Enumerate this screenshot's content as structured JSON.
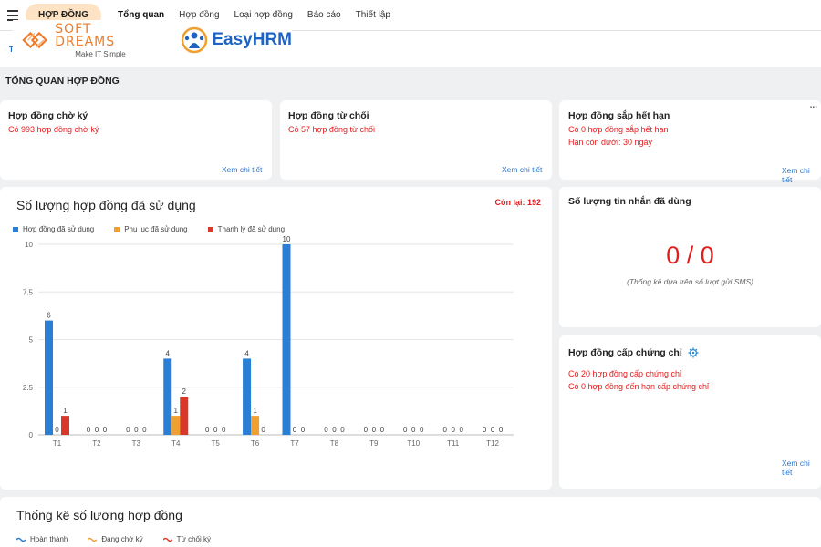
{
  "nav": {
    "module": "HỢP ĐỒNG",
    "items": [
      {
        "label": "Tổng quan",
        "active": true
      },
      {
        "label": "Hợp đồng",
        "active": false
      },
      {
        "label": "Loại hợp đồng",
        "active": false
      },
      {
        "label": "Báo cáo",
        "active": false
      },
      {
        "label": "Thiết lập",
        "active": false
      }
    ]
  },
  "tab_fragment": "Tổ",
  "logos": {
    "softdreams_name": "SOFT DREAMS",
    "softdreams_tagline": "Make IT Simple",
    "easyhrm": "EasyHRM"
  },
  "page": {
    "section_title": "TỔNG QUAN HỢP ĐỒNG"
  },
  "cards": {
    "pending": {
      "title": "Hợp đồng chờ ký",
      "line1": "Có 993 hợp đồng chờ ký",
      "link": "Xem chi tiết"
    },
    "rejected": {
      "title": "Hợp đồng từ chối",
      "line1": "Có 57 hợp đồng từ chối",
      "link": "Xem chi tiết"
    },
    "expiring": {
      "title": "Hợp đồng sắp hết hạn",
      "line1": "Có 0 hợp đồng sắp hết hạn",
      "line2": "Hạn còn dưới: 30 ngày",
      "link": "Xem chi tiết",
      "more": "..."
    },
    "sms": {
      "title": "Số lượng tin nhắn đã dùng",
      "value": "0 / 0",
      "note": "(Thống kê dựa trên số lượt gửi SMS)"
    },
    "certificate": {
      "title": "Hợp đồng cấp chứng chỉ",
      "line1": "Có 20 hợp đồng cấp chứng chỉ",
      "line2": "Có 0 hợp đồng đến hạn cấp chứng chỉ",
      "link": "Xem chi tiết"
    },
    "stats": {
      "title": "Thống kê số lượng hợp đồng",
      "legend": [
        {
          "label": "Hoàn thành",
          "color": "#2a7ed3"
        },
        {
          "label": "Đang chờ ký",
          "color": "#f0a030"
        },
        {
          "label": "Từ chối ký",
          "color": "#d8372a"
        }
      ]
    }
  },
  "usage": {
    "title": "Số lượng hợp đồng đã sử dụng",
    "remaining": "Còn lại: 192"
  },
  "chart_data": {
    "type": "bar",
    "categories": [
      "T1",
      "T2",
      "T3",
      "T4",
      "T5",
      "T6",
      "T7",
      "T8",
      "T9",
      "T10",
      "T11",
      "T12"
    ],
    "series": [
      {
        "name": "Hợp đồng đã sử dụng",
        "color": "#2a7ed3",
        "values": [
          6,
          0,
          0,
          4,
          0,
          4,
          10,
          0,
          0,
          0,
          0,
          0
        ]
      },
      {
        "name": "Phụ lục đã sử dụng",
        "color": "#f0a030",
        "values": [
          0,
          0,
          0,
          1,
          0,
          1,
          0,
          0,
          0,
          0,
          0,
          0
        ]
      },
      {
        "name": "Thanh lý đã sử dụng",
        "color": "#d8372a",
        "values": [
          1,
          0,
          0,
          2,
          0,
          0,
          0,
          0,
          0,
          0,
          0,
          0
        ]
      }
    ],
    "yticks": [
      "0",
      "2.5",
      "5",
      "7.5",
      "10"
    ],
    "ylim": [
      0,
      10
    ],
    "grid": true,
    "legend": "top-left"
  }
}
